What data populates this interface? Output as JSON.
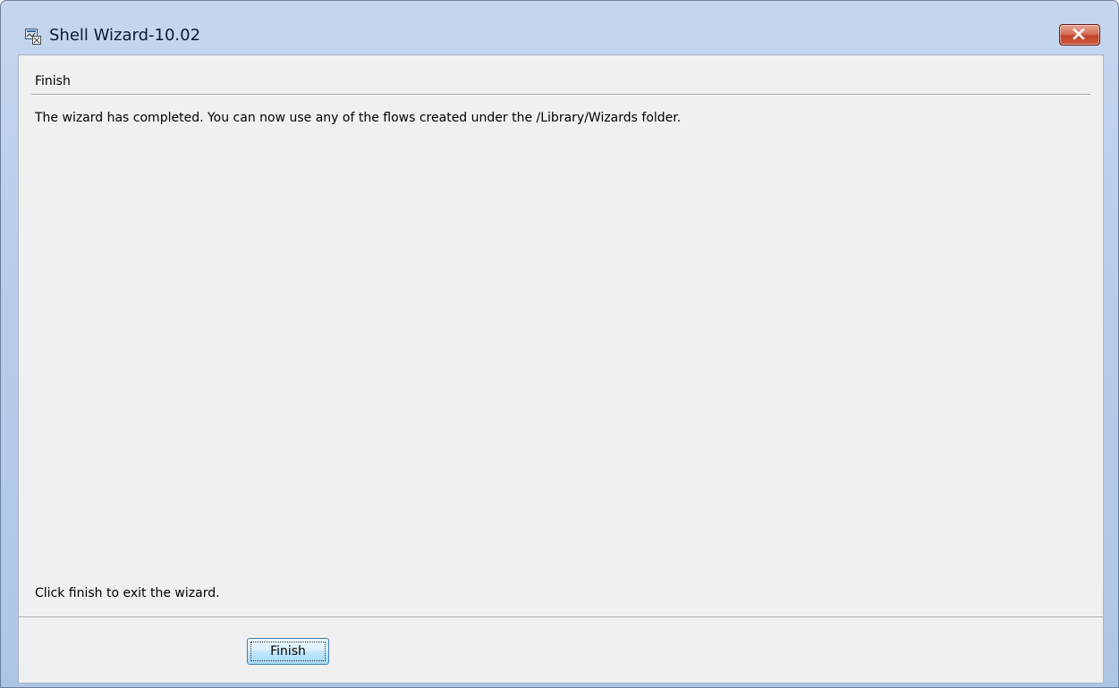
{
  "window": {
    "title": "Shell Wizard-10.02",
    "icon": "shell-wizard-app-icon",
    "close_icon": "close-icon"
  },
  "page": {
    "section_title": "Finish",
    "message": "The wizard has completed. You can now use any of the flows created under the /Library/Wizards folder.",
    "hint": "Click finish to exit the wizard."
  },
  "buttons": {
    "finish_label": "Finish"
  },
  "colors": {
    "client_background": "#f0f0f0",
    "titlebar": "#b9cde9",
    "close_button": "#c3432a"
  }
}
